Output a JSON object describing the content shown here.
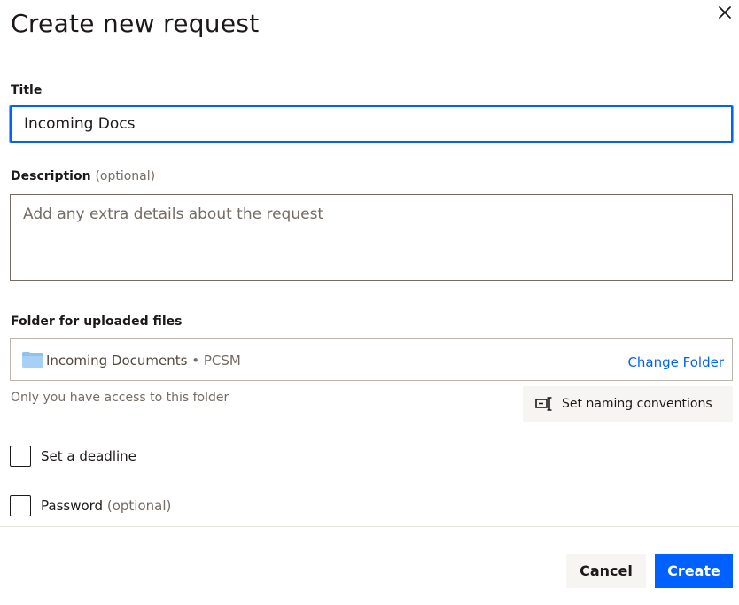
{
  "dialog": {
    "title": "Create new request",
    "close_icon": "close-icon"
  },
  "title_field": {
    "label": "Title",
    "value": "Incoming Docs"
  },
  "description_field": {
    "label": "Description",
    "optional": "(optional)",
    "placeholder": "Add any extra details about the request"
  },
  "folder": {
    "label": "Folder for uploaded files",
    "icon": "folder-icon",
    "name": "Incoming Documents",
    "separator": " • ",
    "owner": "PCSM",
    "change_label": "Change Folder",
    "access_hint": "Only you have access to this folder",
    "naming_button_label": "Set naming conventions",
    "naming_icon": "naming-conventions-icon"
  },
  "options": {
    "deadline_label": "Set a deadline",
    "deadline_checked": false,
    "password_label": "Password",
    "password_optional": "(optional)",
    "password_checked": false
  },
  "footer": {
    "cancel_label": "Cancel",
    "create_label": "Create"
  },
  "colors": {
    "accent": "#0061fe",
    "text": "#1e1919",
    "muted": "#736c64",
    "button_secondary_bg": "#f7f5f2"
  }
}
